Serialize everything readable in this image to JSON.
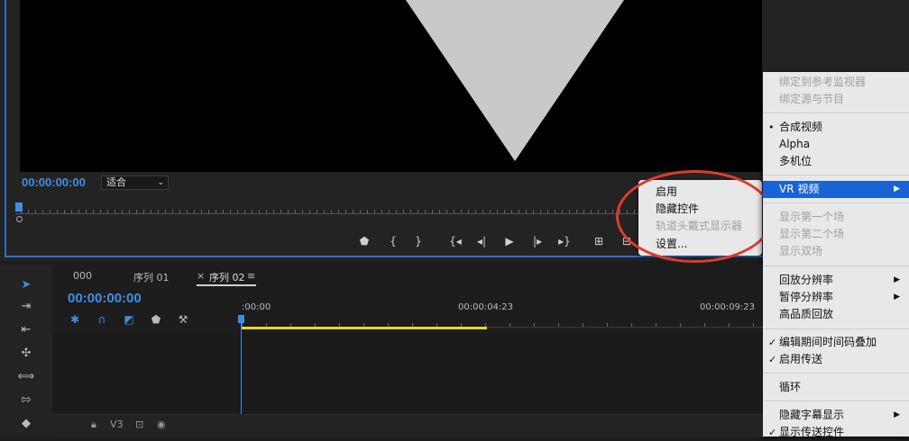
{
  "monitor": {
    "timecode": "00:00:00:00",
    "zoom": "适合",
    "transport": [
      "marker",
      "in",
      "out",
      "go-to-in",
      "step-back",
      "play",
      "step-forward",
      "go-to-out",
      "lift",
      "extract"
    ]
  },
  "context_menu": {
    "items": [
      {
        "label": "启用",
        "disabled": false
      },
      {
        "label": "隐藏控件",
        "disabled": false
      },
      {
        "label": "轨道头戴式显示器",
        "disabled": true
      },
      {
        "label": "设置...",
        "disabled": false
      }
    ]
  },
  "main_menu": {
    "items": [
      {
        "label": "绑定到参考监视器",
        "disabled": true
      },
      {
        "label": "绑定源与节目",
        "disabled": true
      },
      {
        "label": "合成视频",
        "mark": "•"
      },
      {
        "label": "Alpha"
      },
      {
        "label": "多机位"
      },
      {
        "label": "VR 视频",
        "submenu": true,
        "selected": true
      },
      {
        "label": "显示第一个场",
        "disabled": true
      },
      {
        "label": "显示第二个场",
        "disabled": true
      },
      {
        "label": "显示双场",
        "disabled": true
      },
      {
        "label": "回放分辨率",
        "submenu": true
      },
      {
        "label": "暂停分辨率",
        "submenu": true
      },
      {
        "label": "高品质回放"
      },
      {
        "label": "编辑期间时间码叠加",
        "mark": "✓"
      },
      {
        "label": "启用传送",
        "mark": "✓"
      },
      {
        "label": "循环"
      },
      {
        "label": "隐藏字幕显示",
        "submenu": true
      },
      {
        "label": "显示传送控件",
        "mark": "✓"
      }
    ]
  },
  "timeline": {
    "tabs": [
      {
        "label": "000"
      },
      {
        "label": "序列 01"
      },
      {
        "label": "序列 02",
        "active": true
      }
    ],
    "close_glyph": "×",
    "menu_glyph": "≡",
    "timecode": "00:00:00:00",
    "ruler": [
      ":00:00",
      "00:00:04:23",
      "00:00:09:23"
    ],
    "track": "V3"
  }
}
